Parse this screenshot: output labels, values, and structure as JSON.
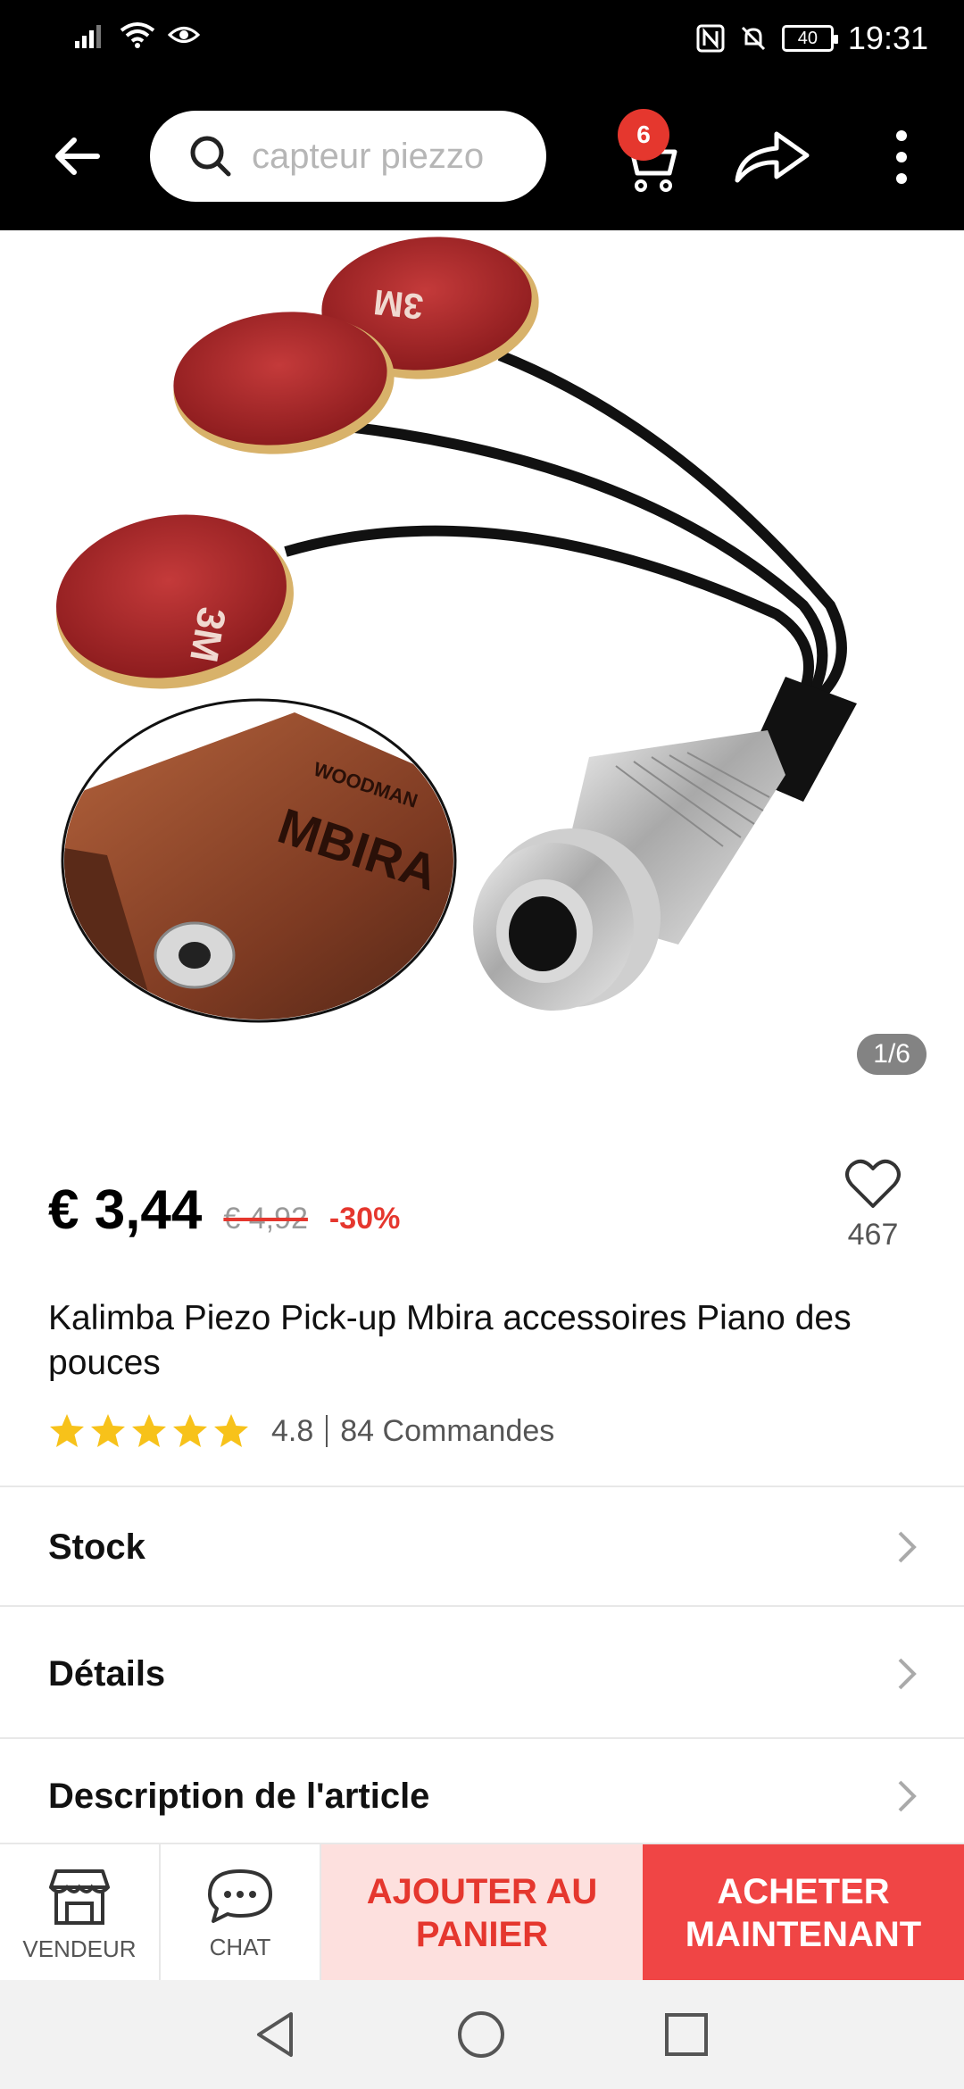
{
  "status_bar": {
    "time": "19:31",
    "battery": "40"
  },
  "header": {
    "search_placeholder": "capteur piezzo",
    "cart_count": "6"
  },
  "gallery": {
    "counter": "1/6",
    "image_text": {
      "pad_brand": "3M",
      "box_brand": "WOODMAN",
      "box_name": "MBIRA"
    }
  },
  "product": {
    "price": "€ 3,44",
    "old_price": "€ 4,92",
    "discount": "-30%",
    "wishlist_count": "467",
    "title": "Kalimba Piezo Pick-up Mbira accessoires Piano des pouces",
    "rating": "4.8",
    "orders": "84 Commandes",
    "stars": 5
  },
  "sections": [
    {
      "label": "Stock"
    },
    {
      "label": "Détails"
    },
    {
      "label": "Description de l'article"
    }
  ],
  "actions": {
    "seller": "VENDEUR",
    "chat": "CHAT",
    "add_to_cart": "AJOUTER AU PANIER",
    "buy_now": "ACHETER MAINTENANT"
  },
  "colors": {
    "accent": "#e5372e",
    "buy_button": "#f04545",
    "add_cart_bg": "#fde0de",
    "star": "#f7c21a"
  }
}
